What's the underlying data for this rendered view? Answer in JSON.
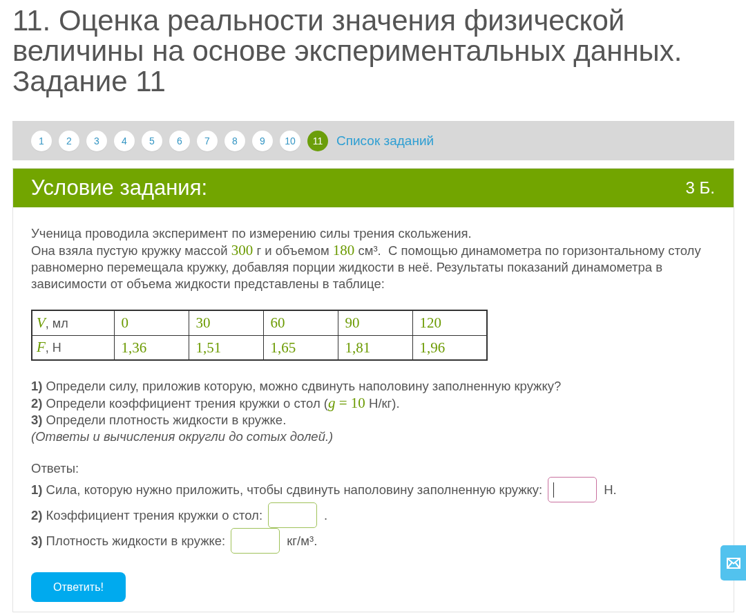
{
  "title": "11. Оценка реальности значения физической величины на основе экспериментальных данных. Задание 11",
  "nav": {
    "items": [
      {
        "label": "1",
        "selected": false
      },
      {
        "label": "2",
        "selected": false
      },
      {
        "label": "3",
        "selected": false
      },
      {
        "label": "4",
        "selected": false
      },
      {
        "label": "5",
        "selected": false
      },
      {
        "label": "6",
        "selected": false
      },
      {
        "label": "7",
        "selected": false
      },
      {
        "label": "8",
        "selected": false
      },
      {
        "label": "9",
        "selected": false
      },
      {
        "label": "10",
        "selected": false
      },
      {
        "label": "11",
        "selected": true
      }
    ],
    "list_link": "Список заданий"
  },
  "task": {
    "header": "Условие задания:",
    "points": "3 Б.",
    "intro": [
      [
        {
          "kind": "text",
          "text": "Ученица проводила эксперимент по измерению силы трения скольжения."
        }
      ],
      [
        {
          "kind": "text",
          "text": "Она взяла пустую кружку массой "
        },
        {
          "kind": "math",
          "text": "300"
        },
        {
          "kind": "text",
          "text": " г и объемом "
        },
        {
          "kind": "math",
          "text": "180"
        },
        {
          "kind": "text",
          "text": " см³.  С помощью динамометра по горизонтальному столу равномерно перемещала кружку, добавляя порции жидкости в неё. Результаты показаний динамометра в зависимости от объема жидкости представлены в таблице:"
        }
      ]
    ],
    "table": {
      "rows": [
        {
          "header": [
            {
              "kind": "math",
              "text": "*V*"
            },
            {
              "kind": "text",
              "text": ", мл"
            }
          ],
          "cells": [
            "0",
            "30",
            "60",
            "90",
            "120"
          ]
        },
        {
          "header": [
            {
              "kind": "math",
              "text": "*F*"
            },
            {
              "kind": "text",
              "text": ", Н"
            }
          ],
          "cells": [
            "1,36",
            "1,51",
            "1,65",
            "1,81",
            "1,96"
          ]
        }
      ]
    },
    "questions": [
      {
        "kind": "question",
        "segments": [
          {
            "kind": "text",
            "text": "**1)** Определи силу, приложив которую, можно сдвинуть наполовину заполненную кружку?"
          }
        ]
      },
      {
        "kind": "question",
        "segments": [
          {
            "kind": "text",
            "text": "**2)** Определи коэффициент трения кружки о стол ("
          },
          {
            "kind": "math",
            "text": "*g* = 10"
          },
          {
            "kind": "text",
            "text": " Н/кг)."
          }
        ]
      },
      {
        "kind": "question",
        "segments": [
          {
            "kind": "text",
            "text": "**3)** Определи плотность жидкости в кружке."
          }
        ]
      },
      {
        "kind": "note",
        "segments": [
          {
            "kind": "text",
            "text": "(Ответы и вычисления округли до сотых долей.)"
          }
        ]
      }
    ]
  },
  "answers": {
    "heading": "Ответы:",
    "items": [
      {
        "label": "**1)** Сила, которую нужно приложить, чтобы сдвинуть наполовину заполненную кружку:",
        "unit": "Н.",
        "focused": true
      },
      {
        "label": "**2)** Коэффициент трения кружки о стол:",
        "unit": ".",
        "focused": false
      },
      {
        "label": "**3)** Плотность жидкости в кружке:",
        "unit": "кг/м³.",
        "focused": false
      }
    ]
  },
  "submit_button": "Ответить!"
}
